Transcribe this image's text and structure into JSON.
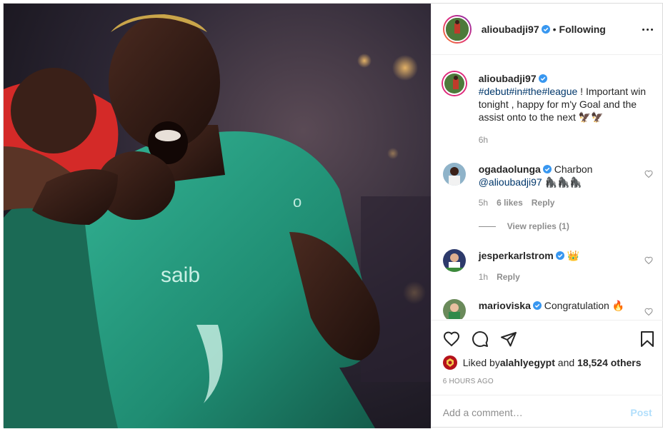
{
  "header": {
    "username": "alioubadji97",
    "separator": "•",
    "follow_status": "Following"
  },
  "caption": {
    "username": "alioubadji97",
    "hashtags": "#debut#in#the#league",
    "text": " ! Important win tonight , happy for m'y Goal and the assist onto to the next 🦅🦅",
    "time": "6h"
  },
  "comments": [
    {
      "username": "ogadaolunga",
      "text": " Charbon",
      "mention": "@alioubadji97",
      "text2": " 🦍🦍🦍",
      "time": "5h",
      "likes": "6 likes",
      "reply": "Reply",
      "view_replies": "View replies (1)"
    },
    {
      "username": "jesperkarlstrom",
      "text": " 👑",
      "time": "1h",
      "reply": "Reply"
    },
    {
      "username": "marioviska",
      "text": " Congratulation 🔥"
    }
  ],
  "likes": {
    "prefix": "Liked by ",
    "user": "alahlyegypt",
    "middle": " and ",
    "count": "18,524 others"
  },
  "timestamp": "6 HOURS AGO",
  "add_comment": {
    "placeholder": "Add a comment…",
    "post_label": "Post"
  },
  "colors": {
    "verified": "#3897f0",
    "link": "#00376b",
    "muted": "#8e8e8e",
    "post_disabled": "#b2dffc"
  },
  "icons": {
    "like": "heart-outline-icon",
    "comment": "comment-bubble-icon",
    "share": "paper-plane-icon",
    "save": "bookmark-icon"
  }
}
